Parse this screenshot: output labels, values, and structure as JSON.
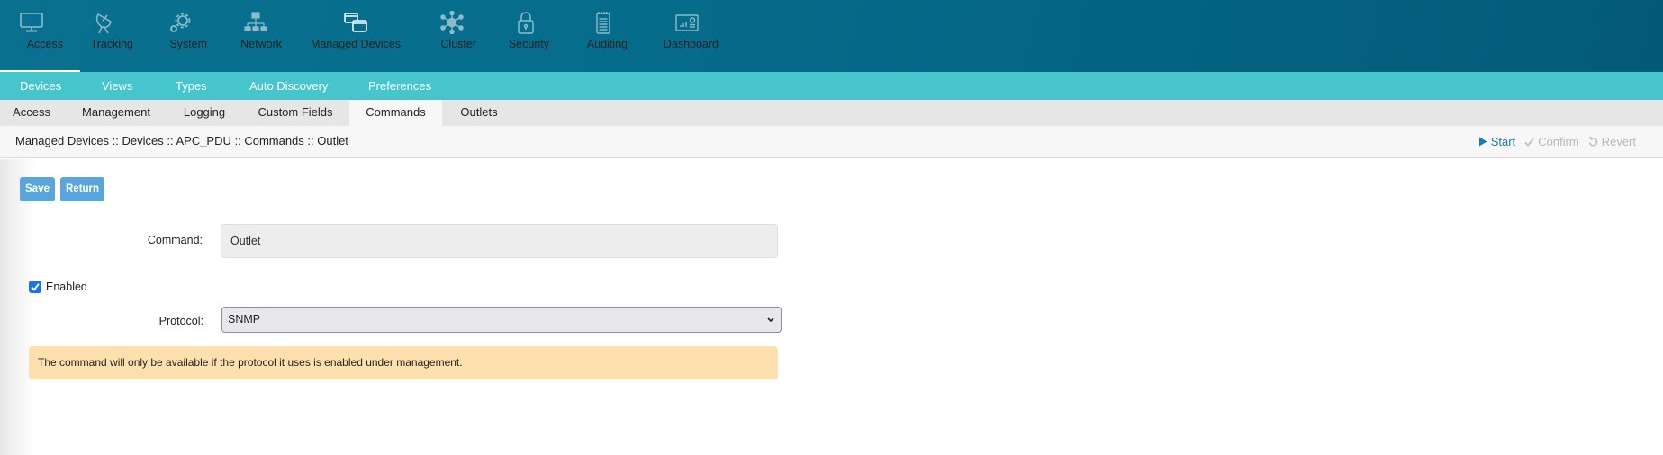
{
  "topnav": {
    "items": [
      {
        "label": "Access",
        "icon": "monitor-icon"
      },
      {
        "label": "Tracking",
        "icon": "satellite-dish-icon"
      },
      {
        "label": "System",
        "icon": "gears-icon"
      },
      {
        "label": "Network",
        "icon": "network-icon"
      },
      {
        "label": "Managed Devices",
        "icon": "windows-icon",
        "active": true
      },
      {
        "label": "Cluster",
        "icon": "cluster-icon"
      },
      {
        "label": "Security",
        "icon": "lock-icon"
      },
      {
        "label": "Auditing",
        "icon": "notepad-icon"
      },
      {
        "label": "Dashboard",
        "icon": "dashboard-icon"
      }
    ]
  },
  "subnav": {
    "items": [
      {
        "label": "Devices",
        "active": true
      },
      {
        "label": "Views"
      },
      {
        "label": "Types"
      },
      {
        "label": "Auto Discovery"
      },
      {
        "label": "Preferences"
      }
    ]
  },
  "tabs": {
    "items": [
      {
        "label": "Access"
      },
      {
        "label": "Management"
      },
      {
        "label": "Logging"
      },
      {
        "label": "Custom Fields"
      },
      {
        "label": "Commands",
        "active": true
      },
      {
        "label": "Outlets"
      }
    ]
  },
  "breadcrumb": "Managed Devices :: Devices :: APC_PDU :: Commands :: Outlet",
  "actions": {
    "start": "Start",
    "confirm": "Confirm",
    "revert": "Revert"
  },
  "buttons": {
    "save": "Save",
    "return": "Return"
  },
  "form": {
    "command_label": "Command:",
    "command_value": "Outlet",
    "enabled_label": "Enabled",
    "enabled_checked": true,
    "protocol_label": "Protocol:",
    "protocol_value": "SNMP"
  },
  "warning": "The command will only be available if the protocol it uses is enabled under management.",
  "colors": {
    "topnav_bg": "#066c8c",
    "subnav_bg": "#46c6cc",
    "button_bg": "#5aa6dc",
    "start_link": "#1a7bb5",
    "warning_bg": "#fde0ad",
    "checkbox": "#1a73e8"
  }
}
